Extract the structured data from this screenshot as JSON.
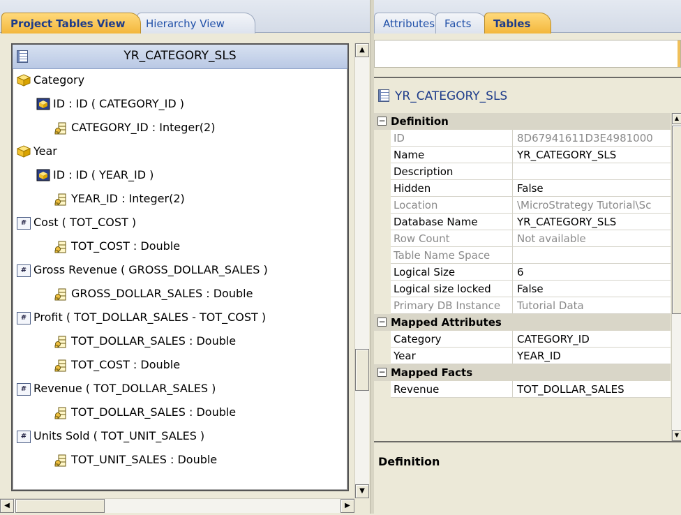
{
  "left_tabs": {
    "project": "Project Tables View",
    "hierarchy": "Hierarchy View"
  },
  "tree": {
    "header": "YR_CATEGORY_SLS",
    "rows": [
      {
        "label": "Category",
        "icon": "attribute-cube-icon"
      },
      {
        "label": "ID : ID ( CATEGORY_ID )",
        "icon": "form-id-icon"
      },
      {
        "label": "CATEGORY_ID : Integer(2)",
        "icon": "column-key-icon"
      },
      {
        "label": "Year",
        "icon": "attribute-cube-icon"
      },
      {
        "label": "ID : ID ( YEAR_ID )",
        "icon": "form-id-icon"
      },
      {
        "label": "YEAR_ID : Integer(2)",
        "icon": "column-key-icon"
      },
      {
        "label": "Cost ( TOT_COST )",
        "icon": "fact-icon"
      },
      {
        "label": "TOT_COST : Double",
        "icon": "column-key-icon"
      },
      {
        "label": "Gross Revenue ( GROSS_DOLLAR_SALES )",
        "icon": "fact-icon"
      },
      {
        "label": "GROSS_DOLLAR_SALES : Double",
        "icon": "column-key-icon"
      },
      {
        "label": "Profit ( TOT_DOLLAR_SALES - TOT_COST )",
        "icon": "fact-icon"
      },
      {
        "label": "TOT_DOLLAR_SALES : Double",
        "icon": "column-key-icon"
      },
      {
        "label": "TOT_COST : Double",
        "icon": "column-key-icon"
      },
      {
        "label": "Revenue ( TOT_DOLLAR_SALES )",
        "icon": "fact-icon"
      },
      {
        "label": "TOT_DOLLAR_SALES : Double",
        "icon": "column-key-icon"
      },
      {
        "label": "Units Sold ( TOT_UNIT_SALES )",
        "icon": "fact-icon"
      },
      {
        "label": "TOT_UNIT_SALES : Double",
        "icon": "column-key-icon"
      }
    ]
  },
  "right_tabs": {
    "attributes": "Attributes",
    "facts": "Facts",
    "tables": "Tables"
  },
  "properties": {
    "title": "YR_CATEGORY_SLS",
    "sections": {
      "definition": "Definition",
      "mapped_attributes": "Mapped Attributes",
      "mapped_facts": "Mapped Facts"
    },
    "definition_rows": [
      {
        "name": "ID",
        "value": "8D67941611D3E4981000",
        "readonly": true
      },
      {
        "name": "Name",
        "value": "YR_CATEGORY_SLS",
        "readonly": false
      },
      {
        "name": "Description",
        "value": "",
        "readonly": false
      },
      {
        "name": "Hidden",
        "value": "False",
        "readonly": false
      },
      {
        "name": "Location",
        "value": "\\MicroStrategy Tutorial\\Sc",
        "readonly": true
      },
      {
        "name": "Database Name",
        "value": "YR_CATEGORY_SLS",
        "readonly": false
      },
      {
        "name": "Row Count",
        "value": "Not available",
        "readonly": true
      },
      {
        "name": "Table Name Space",
        "value": "",
        "readonly": true
      },
      {
        "name": "Logical Size",
        "value": "6",
        "readonly": false
      },
      {
        "name": "Logical size locked",
        "value": "False",
        "readonly": false
      },
      {
        "name": "Primary DB Instance",
        "value": "Tutorial Data",
        "readonly": true
      }
    ],
    "attribute_rows": [
      {
        "name": "Category",
        "value": "CATEGORY_ID"
      },
      {
        "name": "Year",
        "value": "YEAR_ID"
      }
    ],
    "fact_rows": [
      {
        "name": "Revenue",
        "value": "TOT_DOLLAR_SALES"
      }
    ]
  },
  "description_panel": {
    "label": "Definition"
  },
  "colors": {
    "active_tab": "#f3b73c",
    "header_blue": "#b9c8e4",
    "title_blue": "#1d3b8a"
  }
}
